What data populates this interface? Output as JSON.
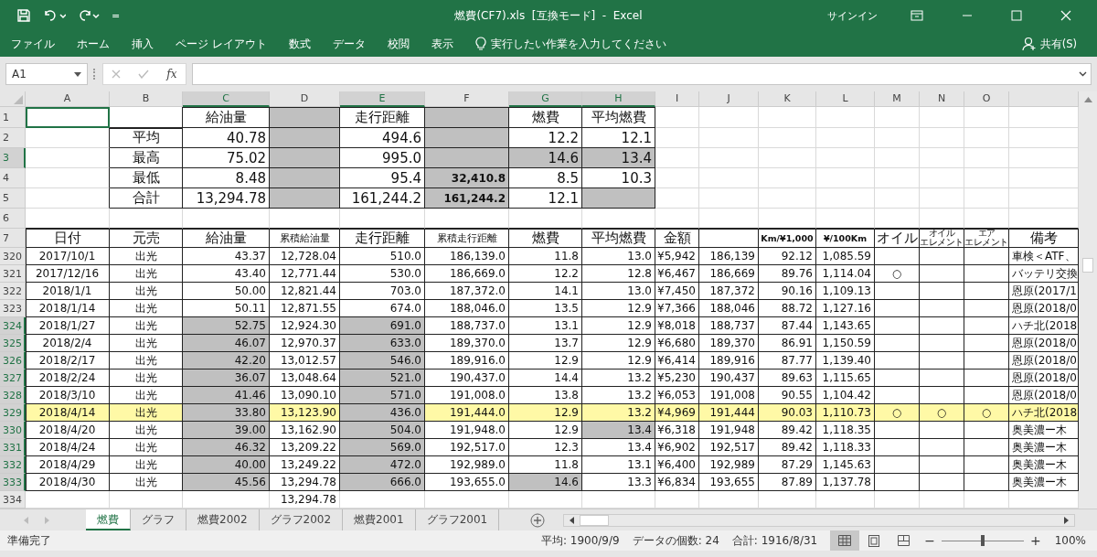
{
  "window": {
    "title": "燃費(CF7).xls  [互換モード]  -  Excel",
    "signin": "サインイン"
  },
  "quick_access": {
    "customize": "="
  },
  "menu": {
    "items": [
      {
        "label": "ファイル"
      },
      {
        "label": "ホーム"
      },
      {
        "label": "挿入"
      },
      {
        "label": "ページ レイアウト"
      },
      {
        "label": "数式"
      },
      {
        "label": "データ"
      },
      {
        "label": "校閲"
      },
      {
        "label": "表示"
      }
    ],
    "tell_me": "実行したい作業を入力してください",
    "share": "共有(S)"
  },
  "formula_bar": {
    "name_box": "A1",
    "fx": "fx"
  },
  "sheet": {
    "columns": [
      {
        "label": "A",
        "selected": false
      },
      {
        "label": "B",
        "selected": false
      },
      {
        "label": "C",
        "selected": true
      },
      {
        "label": "D",
        "selected": false
      },
      {
        "label": "E",
        "selected": true
      },
      {
        "label": "F",
        "selected": false
      },
      {
        "label": "G",
        "selected": true
      },
      {
        "label": "H",
        "selected": true
      },
      {
        "label": "I",
        "selected": false
      },
      {
        "label": "J",
        "selected": false
      },
      {
        "label": "K",
        "selected": false
      },
      {
        "label": "L",
        "selected": false
      },
      {
        "label": "M",
        "selected": false
      },
      {
        "label": "N",
        "selected": false
      },
      {
        "label": "O",
        "selected": false
      },
      {
        "selected": false
      }
    ],
    "rows": [
      {
        "number": "1",
        "selected": false,
        "kind": "title",
        "framed": true,
        "highlighted": false,
        "cells": [
          {
            "shaded": false,
            "active": true
          },
          {
            "shaded": false
          },
          {
            "text": "給油量",
            "shaded": false
          },
          {
            "shaded": true
          },
          {
            "text": "走行距離",
            "shaded": false
          },
          {
            "shaded": true
          },
          {
            "text": "燃費",
            "shaded": false
          },
          {
            "text": "平均燃費",
            "shaded": false
          },
          {
            "shaded": false
          },
          {
            "shaded": false
          },
          {
            "shaded": false
          },
          {
            "shaded": false
          },
          {
            "shaded": false
          },
          {
            "shaded": false
          },
          {
            "shaded": false
          },
          {
            "shaded": false
          }
        ]
      },
      {
        "number": "2",
        "selected": false,
        "kind": "summary",
        "framed": true,
        "highlighted": false,
        "cells": [
          {
            "shaded": false
          },
          {
            "text": "平均",
            "shaded": false
          },
          {
            "text": "40.78",
            "shaded": false
          },
          {
            "shaded": true
          },
          {
            "text": "494.6",
            "shaded": false
          },
          {
            "shaded": true
          },
          {
            "text": "12.2",
            "shaded": false
          },
          {
            "text": "12.1",
            "shaded": false
          },
          {
            "shaded": false
          },
          {
            "shaded": false
          },
          {
            "shaded": false
          },
          {
            "shaded": false
          },
          {
            "shaded": false
          },
          {
            "shaded": false
          },
          {
            "shaded": false
          },
          {
            "shaded": false
          }
        ]
      },
      {
        "number": "3",
        "selected": true,
        "kind": "summary",
        "framed": true,
        "highlighted": false,
        "cells": [
          {
            "shaded": false
          },
          {
            "text": "最高",
            "shaded": false
          },
          {
            "text": "75.02",
            "shaded": false
          },
          {
            "shaded": true
          },
          {
            "text": "995.0",
            "shaded": false
          },
          {
            "shaded": true
          },
          {
            "text": "14.6",
            "shaded": true
          },
          {
            "text": "13.4",
            "shaded": true
          },
          {
            "shaded": false
          },
          {
            "shaded": false
          },
          {
            "shaded": false
          },
          {
            "shaded": false
          },
          {
            "shaded": false
          },
          {
            "shaded": false
          },
          {
            "shaded": false
          },
          {
            "shaded": false
          }
        ]
      },
      {
        "number": "4",
        "selected": false,
        "kind": "summary",
        "framed": true,
        "highlighted": false,
        "cells": [
          {
            "shaded": false
          },
          {
            "text": "最低",
            "shaded": false
          },
          {
            "text": "8.48",
            "shaded": false
          },
          {
            "shaded": true
          },
          {
            "text": "95.4",
            "shaded": false
          },
          {
            "text": "32,410.8",
            "shaded": true,
            "bold": true
          },
          {
            "text": "8.5",
            "shaded": false
          },
          {
            "text": "10.3",
            "shaded": false
          },
          {
            "shaded": false
          },
          {
            "shaded": false
          },
          {
            "shaded": false
          },
          {
            "shaded": false
          },
          {
            "shaded": false
          },
          {
            "shaded": false
          },
          {
            "shaded": false
          },
          {
            "shaded": false
          }
        ]
      },
      {
        "number": "5",
        "selected": false,
        "kind": "summary",
        "framed": true,
        "highlighted": false,
        "cells": [
          {
            "shaded": false
          },
          {
            "text": "合計",
            "shaded": false
          },
          {
            "text": "13,294.78",
            "shaded": false
          },
          {
            "shaded": true
          },
          {
            "text": "161,244.2",
            "shaded": false
          },
          {
            "text": "161,244.2",
            "shaded": true,
            "bold": true
          },
          {
            "text": "12.1",
            "shaded": false
          },
          {
            "shaded": true
          },
          {
            "shaded": false
          },
          {
            "shaded": false
          },
          {
            "shaded": false
          },
          {
            "shaded": false
          },
          {
            "shaded": false
          },
          {
            "shaded": false
          },
          {
            "shaded": false
          },
          {
            "shaded": false
          }
        ]
      },
      {
        "number": "6",
        "selected": false,
        "kind": "summary",
        "highlighted": false,
        "cells": [
          {
            "shaded": false
          },
          {
            "shaded": false
          },
          {
            "shaded": false
          },
          {
            "shaded": false
          },
          {
            "shaded": false
          },
          {
            "shaded": false
          },
          {
            "shaded": false
          },
          {
            "shaded": false
          },
          {
            "shaded": false
          },
          {
            "shaded": false
          },
          {
            "shaded": false
          },
          {
            "shaded": false
          },
          {
            "shaded": false
          },
          {
            "shaded": false
          },
          {
            "shaded": false
          },
          {
            "shaded": false
          }
        ]
      },
      {
        "number": "7",
        "selected": false,
        "kind": "header",
        "framed": true,
        "highlighted": false,
        "cells": [
          {
            "text": "日付",
            "shaded": false
          },
          {
            "text": "元売",
            "shaded": false
          },
          {
            "text": "給油量",
            "shaded": false
          },
          {
            "text": "累積給油量",
            "shaded": false
          },
          {
            "text": "走行距離",
            "shaded": false
          },
          {
            "text": "累積走行距離",
            "shaded": false
          },
          {
            "text": "燃費",
            "shaded": false
          },
          {
            "text": "平均燃費",
            "shaded": false
          },
          {
            "text": "金額",
            "shaded": false
          },
          {
            "shaded": false
          },
          {
            "text": "Km/¥1,000",
            "shaded": false,
            "bold": true
          },
          {
            "text": "¥/100Km",
            "shaded": false,
            "bold": true
          },
          {
            "text": "オイル",
            "shaded": false
          },
          {
            "lines": [
              "オイル",
              "エレメント"
            ],
            "shaded": false
          },
          {
            "lines": [
              "エア",
              "エレメント"
            ],
            "shaded": false
          },
          {
            "text": "備考",
            "shaded": false
          }
        ]
      },
      {
        "number": "320",
        "selected": false,
        "kind": "data",
        "framed": true,
        "highlighted": false,
        "cells": [
          {
            "text": "2017/10/1",
            "shaded": false
          },
          {
            "text": "出光",
            "shaded": false
          },
          {
            "text": "43.37",
            "shaded": false
          },
          {
            "text": "12,728.04",
            "shaded": false
          },
          {
            "text": "510.0",
            "shaded": false
          },
          {
            "text": "186,139.0",
            "shaded": false
          },
          {
            "text": "11.8",
            "shaded": false
          },
          {
            "text": "13.0",
            "shaded": false
          },
          {
            "text": "¥5,942",
            "shaded": false
          },
          {
            "text": "186,139",
            "shaded": false
          },
          {
            "text": "92.12",
            "shaded": false
          },
          {
            "text": "1,085.59",
            "shaded": false
          },
          {
            "shaded": false
          },
          {
            "shaded": false
          },
          {
            "shaded": false
          },
          {
            "text": "車検＜ATF、",
            "shaded": false
          }
        ]
      },
      {
        "number": "321",
        "selected": false,
        "kind": "data",
        "framed": true,
        "highlighted": false,
        "cells": [
          {
            "text": "2017/12/16",
            "shaded": false
          },
          {
            "text": "出光",
            "shaded": false
          },
          {
            "text": "43.40",
            "shaded": false
          },
          {
            "text": "12,771.44",
            "shaded": false
          },
          {
            "text": "530.0",
            "shaded": false
          },
          {
            "text": "186,669.0",
            "shaded": false
          },
          {
            "text": "12.2",
            "shaded": false
          },
          {
            "text": "12.8",
            "shaded": false
          },
          {
            "text": "¥6,467",
            "shaded": false
          },
          {
            "text": "186,669",
            "shaded": false
          },
          {
            "text": "89.76",
            "shaded": false
          },
          {
            "text": "1,114.04",
            "shaded": false
          },
          {
            "text": "○",
            "shaded": false
          },
          {
            "shaded": false
          },
          {
            "shaded": false
          },
          {
            "text": "バッテリ交換",
            "shaded": false
          }
        ]
      },
      {
        "number": "322",
        "selected": false,
        "kind": "data",
        "framed": true,
        "highlighted": false,
        "cells": [
          {
            "text": "2018/1/1",
            "shaded": false
          },
          {
            "text": "出光",
            "shaded": false
          },
          {
            "text": "50.00",
            "shaded": false
          },
          {
            "text": "12,821.44",
            "shaded": false
          },
          {
            "text": "703.0",
            "shaded": false
          },
          {
            "text": "187,372.0",
            "shaded": false
          },
          {
            "text": "14.1",
            "shaded": false
          },
          {
            "text": "13.0",
            "shaded": false
          },
          {
            "text": "¥7,450",
            "shaded": false
          },
          {
            "text": "187,372",
            "shaded": false
          },
          {
            "text": "90.16",
            "shaded": false
          },
          {
            "text": "1,109.13",
            "shaded": false
          },
          {
            "shaded": false
          },
          {
            "shaded": false
          },
          {
            "shaded": false
          },
          {
            "text": "恩原(2017/1",
            "shaded": false
          }
        ]
      },
      {
        "number": "323",
        "selected": false,
        "kind": "data",
        "framed": true,
        "highlighted": false,
        "cells": [
          {
            "text": "2018/1/14",
            "shaded": false
          },
          {
            "text": "出光",
            "shaded": false
          },
          {
            "text": "50.11",
            "shaded": false
          },
          {
            "text": "12,871.55",
            "shaded": false
          },
          {
            "text": "674.0",
            "shaded": false
          },
          {
            "text": "188,046.0",
            "shaded": false
          },
          {
            "text": "13.5",
            "shaded": false
          },
          {
            "text": "12.9",
            "shaded": false
          },
          {
            "text": "¥7,366",
            "shaded": false
          },
          {
            "text": "188,046",
            "shaded": false
          },
          {
            "text": "88.72",
            "shaded": false
          },
          {
            "text": "1,127.16",
            "shaded": false
          },
          {
            "shaded": false
          },
          {
            "shaded": false
          },
          {
            "shaded": false
          },
          {
            "text": "恩原(2018/0",
            "shaded": false
          }
        ]
      },
      {
        "number": "324",
        "selected": true,
        "kind": "data",
        "framed": true,
        "highlighted": false,
        "cells": [
          {
            "text": "2018/1/27",
            "shaded": false
          },
          {
            "text": "出光",
            "shaded": false
          },
          {
            "text": "52.75",
            "shaded": true
          },
          {
            "text": "12,924.30",
            "shaded": false
          },
          {
            "text": "691.0",
            "shaded": true
          },
          {
            "text": "188,737.0",
            "shaded": false
          },
          {
            "text": "13.1",
            "shaded": false
          },
          {
            "text": "12.9",
            "shaded": false
          },
          {
            "text": "¥8,018",
            "shaded": false
          },
          {
            "text": "188,737",
            "shaded": false
          },
          {
            "text": "87.44",
            "shaded": false
          },
          {
            "text": "1,143.65",
            "shaded": false
          },
          {
            "shaded": false
          },
          {
            "shaded": false
          },
          {
            "shaded": false
          },
          {
            "text": "ハチ北(2018",
            "shaded": false
          }
        ]
      },
      {
        "number": "325",
        "selected": true,
        "kind": "data",
        "framed": true,
        "highlighted": false,
        "cells": [
          {
            "text": "2018/2/4",
            "shaded": false
          },
          {
            "text": "出光",
            "shaded": false
          },
          {
            "text": "46.07",
            "shaded": true
          },
          {
            "text": "12,970.37",
            "shaded": false
          },
          {
            "text": "633.0",
            "shaded": true
          },
          {
            "text": "189,370.0",
            "shaded": false
          },
          {
            "text": "13.7",
            "shaded": false
          },
          {
            "text": "12.9",
            "shaded": false
          },
          {
            "text": "¥6,680",
            "shaded": false
          },
          {
            "text": "189,370",
            "shaded": false
          },
          {
            "text": "86.91",
            "shaded": false
          },
          {
            "text": "1,150.59",
            "shaded": false
          },
          {
            "shaded": false
          },
          {
            "shaded": false
          },
          {
            "shaded": false
          },
          {
            "text": "恩原(2018/0",
            "shaded": false
          }
        ]
      },
      {
        "number": "326",
        "selected": true,
        "kind": "data",
        "framed": true,
        "highlighted": false,
        "cells": [
          {
            "text": "2018/2/17",
            "shaded": false
          },
          {
            "text": "出光",
            "shaded": false
          },
          {
            "text": "42.20",
            "shaded": true
          },
          {
            "text": "13,012.57",
            "shaded": false
          },
          {
            "text": "546.0",
            "shaded": true
          },
          {
            "text": "189,916.0",
            "shaded": false
          },
          {
            "text": "12.9",
            "shaded": false
          },
          {
            "text": "12.9",
            "shaded": false
          },
          {
            "text": "¥6,414",
            "shaded": false
          },
          {
            "text": "189,916",
            "shaded": false
          },
          {
            "text": "87.77",
            "shaded": false
          },
          {
            "text": "1,139.40",
            "shaded": false
          },
          {
            "shaded": false
          },
          {
            "shaded": false
          },
          {
            "shaded": false
          },
          {
            "text": "恩原(2018/0",
            "shaded": false
          }
        ]
      },
      {
        "number": "327",
        "selected": true,
        "kind": "data",
        "framed": true,
        "highlighted": false,
        "cells": [
          {
            "text": "2018/2/24",
            "shaded": false
          },
          {
            "text": "出光",
            "shaded": false
          },
          {
            "text": "36.07",
            "shaded": true
          },
          {
            "text": "13,048.64",
            "shaded": false
          },
          {
            "text": "521.0",
            "shaded": true
          },
          {
            "text": "190,437.0",
            "shaded": false
          },
          {
            "text": "14.4",
            "shaded": false
          },
          {
            "text": "13.2",
            "shaded": false
          },
          {
            "text": "¥5,230",
            "shaded": false
          },
          {
            "text": "190,437",
            "shaded": false
          },
          {
            "text": "89.63",
            "shaded": false
          },
          {
            "text": "1,115.65",
            "shaded": false
          },
          {
            "shaded": false
          },
          {
            "shaded": false
          },
          {
            "shaded": false
          },
          {
            "text": "恩原(2018/0",
            "shaded": false
          }
        ]
      },
      {
        "number": "328",
        "selected": true,
        "kind": "data",
        "framed": true,
        "highlighted": false,
        "cells": [
          {
            "text": "2018/3/10",
            "shaded": false
          },
          {
            "text": "出光",
            "shaded": false
          },
          {
            "text": "41.46",
            "shaded": true
          },
          {
            "text": "13,090.10",
            "shaded": false
          },
          {
            "text": "571.0",
            "shaded": true
          },
          {
            "text": "191,008.0",
            "shaded": false
          },
          {
            "text": "13.8",
            "shaded": false
          },
          {
            "text": "13.2",
            "shaded": false
          },
          {
            "text": "¥6,053",
            "shaded": false
          },
          {
            "text": "191,008",
            "shaded": false
          },
          {
            "text": "90.55",
            "shaded": false
          },
          {
            "text": "1,104.42",
            "shaded": false
          },
          {
            "shaded": false
          },
          {
            "shaded": false
          },
          {
            "shaded": false
          },
          {
            "text": "恩原(2018/0",
            "shaded": false
          }
        ]
      },
      {
        "number": "329",
        "selected": true,
        "kind": "data",
        "framed": true,
        "highlighted": true,
        "cells": [
          {
            "text": "2018/4/14",
            "shaded": false
          },
          {
            "text": "出光",
            "shaded": false
          },
          {
            "text": "33.80",
            "shaded": true
          },
          {
            "text": "13,123.90",
            "shaded": false
          },
          {
            "text": "436.0",
            "shaded": true
          },
          {
            "text": "191,444.0",
            "shaded": false
          },
          {
            "text": "12.9",
            "shaded": false
          },
          {
            "text": "13.2",
            "shaded": false
          },
          {
            "text": "¥4,969",
            "shaded": false
          },
          {
            "text": "191,444",
            "shaded": false
          },
          {
            "text": "90.03",
            "shaded": false
          },
          {
            "text": "1,110.73",
            "shaded": false
          },
          {
            "text": "○",
            "shaded": false
          },
          {
            "text": "○",
            "shaded": false
          },
          {
            "text": "○",
            "shaded": false
          },
          {
            "text": "ハチ北(2018",
            "shaded": false
          }
        ]
      },
      {
        "number": "330",
        "selected": true,
        "kind": "data",
        "framed": true,
        "highlighted": false,
        "cells": [
          {
            "text": "2018/4/20",
            "shaded": false
          },
          {
            "text": "出光",
            "shaded": false
          },
          {
            "text": "39.00",
            "shaded": true
          },
          {
            "text": "13,162.90",
            "shaded": false
          },
          {
            "text": "504.0",
            "shaded": true
          },
          {
            "text": "191,948.0",
            "shaded": false
          },
          {
            "text": "12.9",
            "shaded": false
          },
          {
            "text": "13.4",
            "shaded": true
          },
          {
            "text": "¥6,318",
            "shaded": false
          },
          {
            "text": "191,948",
            "shaded": false
          },
          {
            "text": "89.42",
            "shaded": false
          },
          {
            "text": "1,118.35",
            "shaded": false
          },
          {
            "shaded": false
          },
          {
            "shaded": false
          },
          {
            "shaded": false
          },
          {
            "text": "奥美濃ー木",
            "shaded": false
          }
        ]
      },
      {
        "number": "331",
        "selected": true,
        "kind": "data",
        "framed": true,
        "highlighted": false,
        "cells": [
          {
            "text": "2018/4/24",
            "shaded": false
          },
          {
            "text": "出光",
            "shaded": false
          },
          {
            "text": "46.32",
            "shaded": true
          },
          {
            "text": "13,209.22",
            "shaded": false
          },
          {
            "text": "569.0",
            "shaded": true
          },
          {
            "text": "192,517.0",
            "shaded": false
          },
          {
            "text": "12.3",
            "shaded": false
          },
          {
            "text": "13.4",
            "shaded": false
          },
          {
            "text": "¥6,902",
            "shaded": false
          },
          {
            "text": "192,517",
            "shaded": false
          },
          {
            "text": "89.42",
            "shaded": false
          },
          {
            "text": "1,118.33",
            "shaded": false
          },
          {
            "shaded": false
          },
          {
            "shaded": false
          },
          {
            "shaded": false
          },
          {
            "text": "奥美濃ー木",
            "shaded": false
          }
        ]
      },
      {
        "number": "332",
        "selected": true,
        "kind": "data",
        "framed": true,
        "highlighted": false,
        "cells": [
          {
            "text": "2018/4/29",
            "shaded": false
          },
          {
            "text": "出光",
            "shaded": false
          },
          {
            "text": "40.00",
            "shaded": true
          },
          {
            "text": "13,249.22",
            "shaded": false
          },
          {
            "text": "472.0",
            "shaded": true
          },
          {
            "text": "192,989.0",
            "shaded": false
          },
          {
            "text": "11.8",
            "shaded": false
          },
          {
            "text": "13.1",
            "shaded": false
          },
          {
            "text": "¥6,400",
            "shaded": false
          },
          {
            "text": "192,989",
            "shaded": false
          },
          {
            "text": "87.29",
            "shaded": false
          },
          {
            "text": "1,145.63",
            "shaded": false
          },
          {
            "shaded": false
          },
          {
            "shaded": false
          },
          {
            "shaded": false
          },
          {
            "text": "奥美濃ー木",
            "shaded": false
          }
        ]
      },
      {
        "number": "333",
        "selected": true,
        "kind": "data",
        "framed": true,
        "highlighted": false,
        "cells": [
          {
            "text": "2018/4/30",
            "shaded": false
          },
          {
            "text": "出光",
            "shaded": false
          },
          {
            "text": "45.56",
            "shaded": true
          },
          {
            "text": "13,294.78",
            "shaded": false
          },
          {
            "text": "666.0",
            "shaded": true
          },
          {
            "text": "193,655.0",
            "shaded": false
          },
          {
            "text": "14.6",
            "shaded": true
          },
          {
            "text": "13.3",
            "shaded": false
          },
          {
            "text": "¥6,834",
            "shaded": false
          },
          {
            "text": "193,655",
            "shaded": false
          },
          {
            "text": "87.89",
            "shaded": false
          },
          {
            "text": "1,137.78",
            "shaded": false
          },
          {
            "shaded": false
          },
          {
            "shaded": false
          },
          {
            "shaded": false
          },
          {
            "text": "奥美濃ー木",
            "shaded": false
          }
        ]
      },
      {
        "number": "334",
        "selected": false,
        "kind": "data",
        "framed": false,
        "highlighted": false,
        "cells": [
          {
            "shaded": false
          },
          {
            "shaded": false
          },
          {
            "shaded": false
          },
          {
            "text": "13,294.78",
            "shaded": false
          },
          {
            "shaded": false
          },
          {
            "shaded": false
          },
          {
            "shaded": false
          },
          {
            "shaded": false
          },
          {
            "shaded": false
          },
          {
            "shaded": false
          },
          {
            "shaded": false
          },
          {
            "shaded": false
          },
          {
            "shaded": false
          },
          {
            "shaded": false
          },
          {
            "shaded": false
          },
          {
            "shaded": false
          }
        ]
      }
    ]
  },
  "sheet_tabs": [
    {
      "label": "燃費",
      "selected": true
    },
    {
      "label": "グラフ",
      "selected": false
    },
    {
      "label": "燃費2002",
      "selected": false
    },
    {
      "label": "グラフ2002",
      "selected": false
    },
    {
      "label": "燃費2001",
      "selected": false
    },
    {
      "label": "グラフ2001",
      "selected": false
    }
  ],
  "status_bar": {
    "ready": "準備完了",
    "average": "平均: 1900/9/9",
    "count": "データの個数: 24",
    "sum": "合計: 1916/8/31",
    "views": [
      {
        "kind": "normal",
        "selected": true
      },
      {
        "kind": "page_layout",
        "selected": false
      },
      {
        "kind": "page_break",
        "selected": false
      }
    ],
    "zoom": {
      "out": "−",
      "level": 0.5,
      "in": "+",
      "reading": "100%"
    }
  }
}
